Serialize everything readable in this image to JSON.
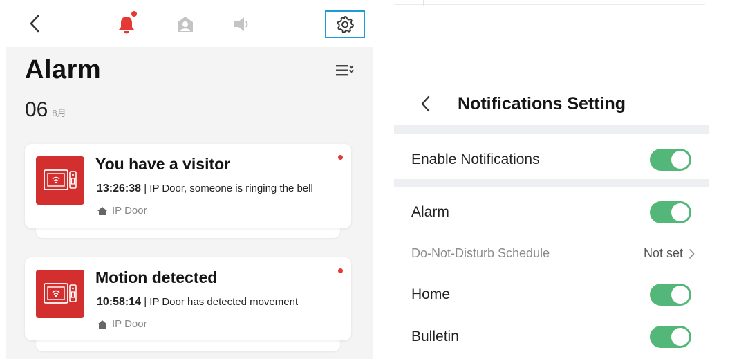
{
  "alarm_screen": {
    "title": "Alarm",
    "date_day": "06",
    "date_month": "8月",
    "notifications": [
      {
        "title": "You have a visitor",
        "time": "13:26:38",
        "separator": " | ",
        "description": "IP Door, someone is ringing the bell",
        "source": "IP Door"
      },
      {
        "title": "Motion detected",
        "time": "10:58:14",
        "separator": " | ",
        "description": "IP Door has detected movement",
        "source": "IP Door"
      }
    ]
  },
  "settings_screen": {
    "title": "Notifications Setting",
    "enable_notifications": {
      "label": "Enable Notifications",
      "enabled": true
    },
    "alarm": {
      "label": "Alarm",
      "enabled": true
    },
    "dnd_schedule": {
      "label": "Do-Not-Disturb Schedule",
      "value": "Not set"
    },
    "home": {
      "label": "Home",
      "enabled": true
    },
    "bulletin": {
      "label": "Bulletin",
      "enabled": true
    }
  },
  "colors": {
    "accent_red": "#e53935",
    "toggle_green": "#52b779",
    "highlight_blue": "#1e9ad6",
    "thumbnail_red": "#d32f2f"
  },
  "icons": [
    "chevron-left-icon",
    "bell-icon",
    "person-icon",
    "speaker-icon",
    "gear-icon",
    "filter-list-icon",
    "intercom-icon",
    "home-icon",
    "chevron-right-icon"
  ]
}
